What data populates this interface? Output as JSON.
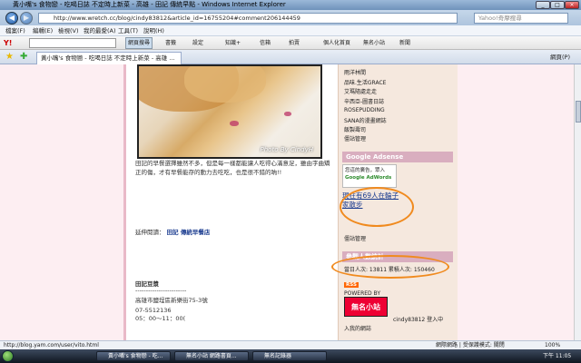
{
  "window": {
    "title": "黃小嘴's 食物戀 - 吃喝日誌 不定時上新菜 - 高雄 - 田記 傳統早點 - Windows Internet Explorer"
  },
  "address": {
    "url": "http://www.wretch.cc/blog/cindy83812&article_id=16755204#comment206144459",
    "search_placeholder": "Yahoo!奇摩搜尋"
  },
  "menu": [
    "檔案(F)",
    "編輯(E)",
    "檢視(V)",
    "我的最愛(A)",
    "工具(T)",
    "說明(H)"
  ],
  "ytoolbar": {
    "logo": "Y!",
    "search_button": "網頁搜尋",
    "items": [
      "書籤",
      "設定",
      "知識+",
      "信箱",
      "拍賣",
      "個人化首頁",
      "無名小站",
      "新聞"
    ]
  },
  "tab": {
    "title": "黃小嘴's 食物戀 - 吃喝日誌 不定時上新菜 - 高雄 ..."
  },
  "tabbar_right": {
    "home": "網頁(P)"
  },
  "photo": {
    "credit": "Photo By CindyH"
  },
  "article": {
    "p1": "田記的早餐選擇雖然不多，但是每一樣都能讓人吃得心滿意足，雖由字曲矯正的傷，才有早餐能存的動力去吃吃，也是很不錯的吶!!",
    "extended_label": "延伸閱讀：",
    "extended_link": "田記 傳統早餐店",
    "shop_name": "田記豆漿",
    "divider": "------------------------",
    "address": "高雄市鹽埕區新樂街75-3號",
    "phone": "07-5512136",
    "hours": "05：00～11：00("
  },
  "sidebar": {
    "links": [
      "雨洋林間",
      "品味.生活GRACE",
      "艾瑪隨處走走",
      "辛西亞-圖書日誌",
      "ROSEPUDDING",
      "SANA的漫畫網誌",
      "飯製壽司",
      "僵站管理"
    ],
    "section1": "Google Adsense",
    "ad_line1": "您這的廣告，眾入",
    "ad_line2": "Google AdWords",
    "online_text": "現在有69人在輪子家散步",
    "mgmt": "僵站管理",
    "section2": "參觀人數統計",
    "stats": "當日人次: 13811 累積人次: 150460",
    "rss": "RSS",
    "powered": "POWERED BY",
    "wretch_logo": "無名小站",
    "footer": "cindy83812 登入中",
    "login": "入我的網誌"
  },
  "status": {
    "url": "http://blog.yam.com/user/vito.html",
    "zone": "網際網路 | 受保護模式: 關閉",
    "zoom": "100%"
  },
  "taskbar": {
    "items": [
      "黃小嘴's 食物戀 - 吃...",
      "無名小站 網路書頁...",
      "無名記錄器"
    ],
    "clock": "下午 11:05"
  }
}
